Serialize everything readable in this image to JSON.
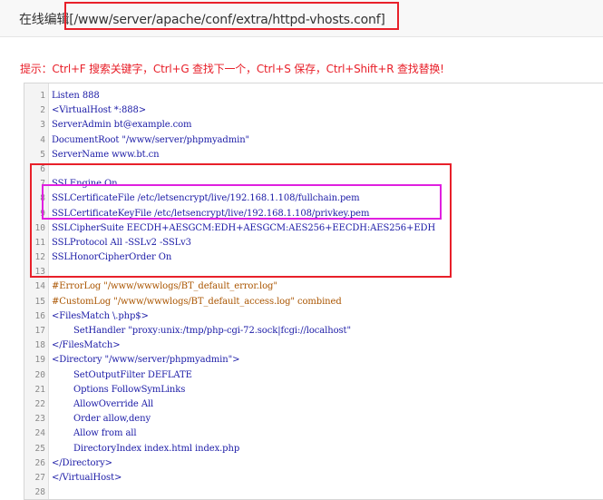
{
  "header": {
    "title": "在线编辑[/www/server/apache/conf/extra/httpd-vhosts.conf]"
  },
  "tip": "提示：Ctrl+F 搜索关键字，Ctrl+G 查找下一个，Ctrl+S 保存，Ctrl+Shift+R 查找替换!",
  "editor": {
    "lines": [
      {
        "num": "1",
        "text": "Listen 888"
      },
      {
        "num": "2",
        "text": "<VirtualHost *:888>"
      },
      {
        "num": "3",
        "text": "ServerAdmin bt@example.com"
      },
      {
        "num": "4",
        "text": "DocumentRoot \"/www/server/phpmyadmin\""
      },
      {
        "num": "5",
        "text": "ServerName www.bt.cn"
      },
      {
        "num": "6",
        "text": ""
      },
      {
        "num": "7",
        "text": "SSLEngine On"
      },
      {
        "num": "8",
        "text": "SSLCertificateFile /etc/letsencrypt/live/192.168.1.108/fullchain.pem"
      },
      {
        "num": "9",
        "text": "SSLCertificateKeyFile /etc/letsencrypt/live/192.168.1.108/privkey.pem"
      },
      {
        "num": "10",
        "text": "SSLCipherSuite EECDH+AESGCM:EDH+AESGCM:AES256+EECDH:AES256+EDH"
      },
      {
        "num": "11",
        "text": "SSLProtocol All -SSLv2 -SSLv3"
      },
      {
        "num": "12",
        "text": "SSLHonorCipherOrder On"
      },
      {
        "num": "13",
        "text": ""
      },
      {
        "num": "14",
        "text": "#ErrorLog \"/www/wwwlogs/BT_default_error.log\""
      },
      {
        "num": "15",
        "text": "#CustomLog \"/www/wwwlogs/BT_default_access.log\" combined"
      },
      {
        "num": "16",
        "text": "<FilesMatch \\.php$>"
      },
      {
        "num": "17",
        "text": "SetHandler \"proxy:unix:/tmp/php-cgi-72.sock|fcgi://localhost\""
      },
      {
        "num": "18",
        "text": "</FilesMatch>"
      },
      {
        "num": "19",
        "text": "<Directory \"/www/server/phpmyadmin\">"
      },
      {
        "num": "20",
        "text": "SetOutputFilter DEFLATE"
      },
      {
        "num": "21",
        "text": "Options FollowSymLinks"
      },
      {
        "num": "22",
        "text": "AllowOverride All"
      },
      {
        "num": "23",
        "text": "Order allow,deny"
      },
      {
        "num": "24",
        "text": "Allow from all"
      },
      {
        "num": "25",
        "text": "DirectoryIndex index.html index.php"
      },
      {
        "num": "26",
        "text": "</Directory>"
      },
      {
        "num": "27",
        "text": "</VirtualHost>"
      },
      {
        "num": "28",
        "text": ""
      }
    ]
  },
  "colors": {
    "annotation_red": "#e8202a",
    "annotation_magenta": "#e020e0",
    "code_text": "#1a1aa6",
    "comment_text": "#aa5500",
    "tip_text": "#e8202a"
  }
}
